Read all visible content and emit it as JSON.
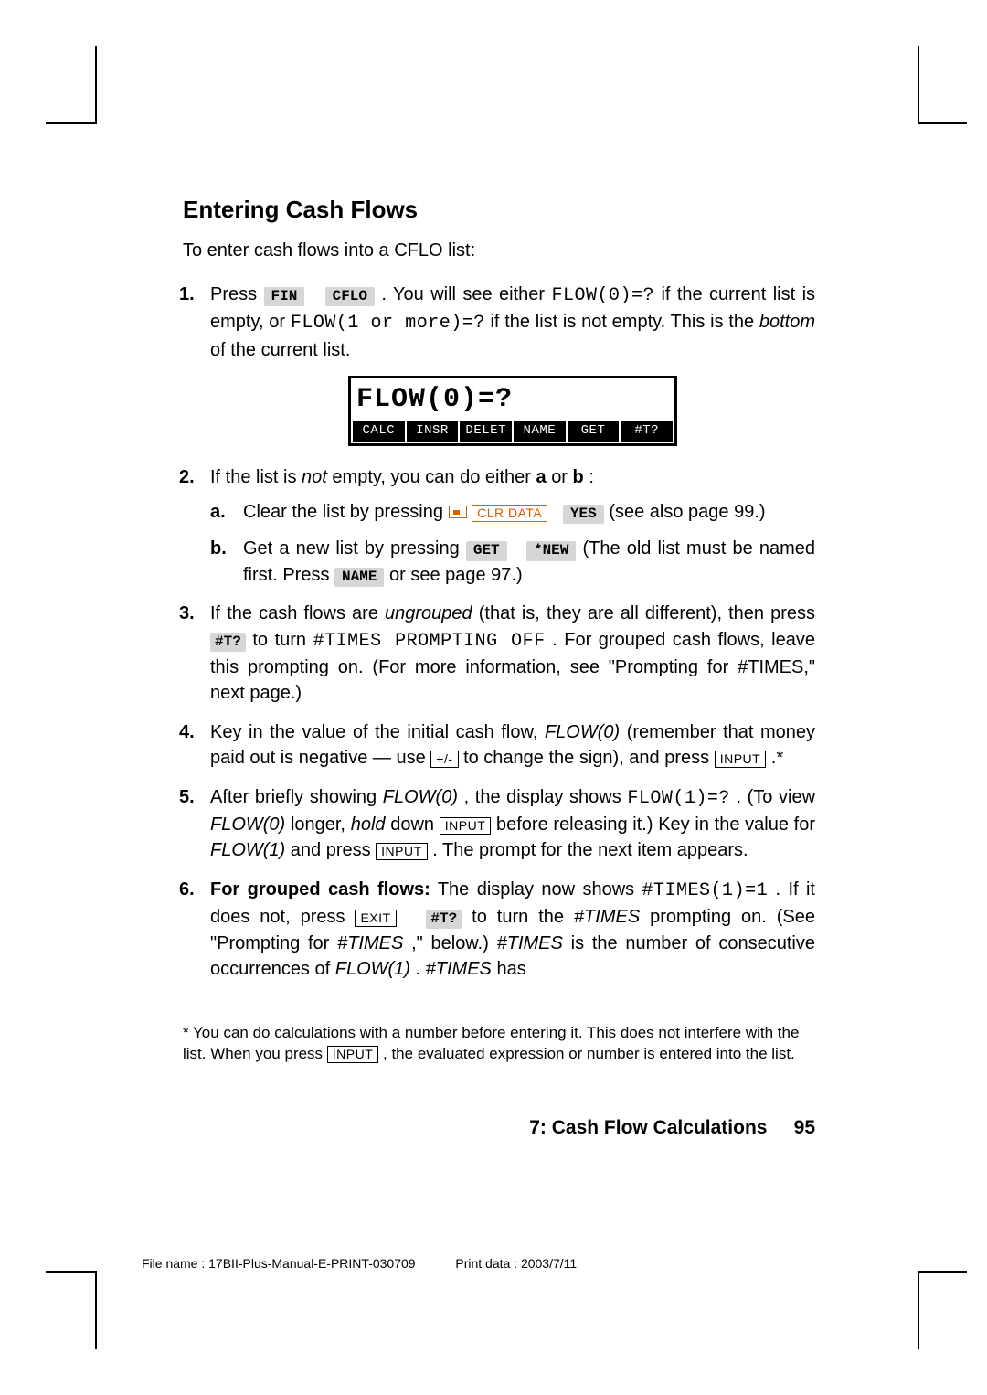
{
  "heading": "Entering Cash Flows",
  "intro": "To enter cash flows into a CFLO list:",
  "buttons": {
    "fin": "FIN",
    "cflo": "CFLO",
    "yes": "YES",
    "get": "GET",
    "new": "*NEW",
    "name": "NAME",
    "tq": "#T?",
    "tq2": "#T?"
  },
  "keys": {
    "clr": "CLR DATA",
    "input": "INPUT",
    "exit": "EXIT",
    "sign": "+/-"
  },
  "steps": {
    "s1a": "Press ",
    "s1b": " . You will see either ",
    "s1c": "FLOW(0)=?",
    "s1d": " if the current list is empty, or ",
    "s1e": "FLOW(1 or more)=?",
    "s1f": " if the list is not empty. This is the ",
    "s1g": "bottom",
    "s1h": " of the current list.",
    "s2a": "If the list is ",
    "s2b": "not",
    "s2c": " empty, you can do either ",
    "s2d": "a",
    "s2e": " or ",
    "s2f": "b",
    "s2g": ":",
    "s2a_a1": "Clear the list by pressing ",
    "s2a_a2": " (see also page 99.)",
    "s2b_b1": "Get a new list by pressing ",
    "s2b_b2": " (The old list must be named first. Press ",
    "s2b_b3": " or see page 97.)",
    "s3a": "If the cash flows are ",
    "s3b": "ungrouped",
    "s3c": " (that is, they are all different), then press ",
    "s3d": " to turn ",
    "s3e": "#TIMES PROMPTING OFF",
    "s3f": ". For grouped cash flows, leave this prompting on. (For more information, see \"Prompting for #TIMES,\" next page.)",
    "s4a": "Key in the value of the initial cash flow, ",
    "s4b": "FLOW(0)",
    "s4c": " (remember that money paid out is negative — use ",
    "s4d": " to change the sign), and press ",
    "s4e": " .",
    "s4f": "*",
    "s5a": "After briefly showing ",
    "s5b": "FLOW(0)",
    "s5c": ", the display shows ",
    "s5d": "FLOW(1)=?",
    "s5e": ". (To view ",
    "s5f": "FLOW(0)",
    "s5g": " longer, ",
    "s5h": "hold",
    "s5i": " down ",
    "s5j": " before releasing it.) Key in the value for ",
    "s5k": "FLOW(1)",
    "s5l": " and press ",
    "s5m": ". The prompt for the next item appears.",
    "s6a": "For grouped cash flows:",
    "s6b": " The display now shows ",
    "s6c": "#TIMES(1)=1",
    "s6d": ". If it does not, press ",
    "s6e": " to turn the ",
    "s6f": "#TIMES",
    "s6g": " prompting on. (See \"Prompting for ",
    "s6h": "#TIMES",
    "s6i": ",\" below.) ",
    "s6j": "#TIMES",
    "s6k": " is the number of consecutive occurrences of ",
    "s6l": "FLOW(1)",
    "s6m": ". ",
    "s6n": "#TIMES",
    "s6o": " has"
  },
  "lcd": {
    "top": "FLOW(0)=?",
    "menu": [
      "CALC",
      "INSR",
      "DELET",
      "NAME",
      "GET",
      "#T?"
    ]
  },
  "footnote": {
    "a": "* You can do calculations with a number before entering it. This does not interfere with the list. When you press ",
    "b": ", the evaluated expression or number is entered into the list."
  },
  "pagefoot": {
    "chapter": "7: Cash Flow Calculations",
    "page": "95"
  },
  "meta": {
    "file": "File name : 17BII-Plus-Manual-E-PRINT-030709",
    "print": "Print data : 2003/7/11"
  }
}
